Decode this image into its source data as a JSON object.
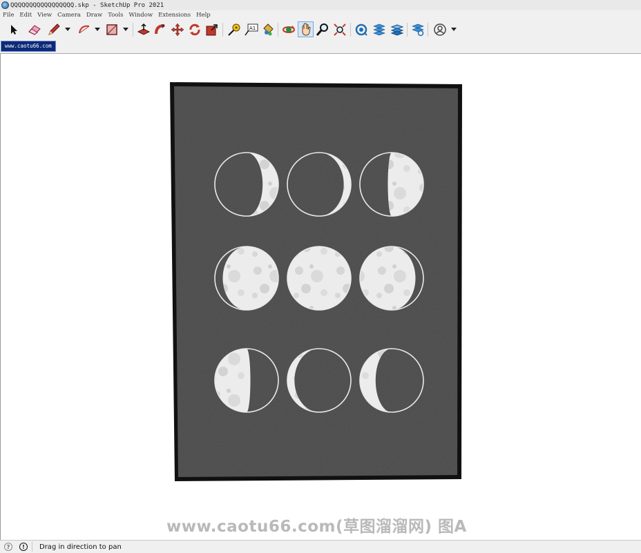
{
  "window": {
    "title": "QQQQQQQQQQQQQQQQQ.skp - SketchUp Pro 2021"
  },
  "menu": {
    "items": [
      "File",
      "Edit",
      "View",
      "Camera",
      "Draw",
      "Tools",
      "Window",
      "Extensions",
      "Help"
    ]
  },
  "toolbar": {
    "tools": [
      {
        "icon": "select-arrow-icon"
      },
      {
        "icon": "eraser-icon"
      },
      {
        "icon": "pencil-line-icon",
        "dropdown": true
      },
      {
        "icon": "arc-icon",
        "dropdown": true
      },
      {
        "icon": "rectangle-icon",
        "dropdown": true
      },
      {
        "icon": "push-pull-icon"
      },
      {
        "icon": "follow-me-icon"
      },
      {
        "icon": "move-icon"
      },
      {
        "icon": "rotate-icon"
      },
      {
        "icon": "scale-icon"
      },
      {
        "icon": "tape-measure-icon"
      },
      {
        "icon": "text-icon",
        "text": "A1"
      },
      {
        "icon": "paint-bucket-icon"
      },
      {
        "icon": "orbit-icon"
      },
      {
        "icon": "pan-hand-icon",
        "active": true
      },
      {
        "icon": "zoom-icon"
      },
      {
        "icon": "zoom-extents-icon"
      },
      {
        "icon": "3d-warehouse-icon"
      },
      {
        "icon": "extension-warehouse-icon"
      },
      {
        "icon": "layout-icon"
      },
      {
        "icon": "extension-manager-icon"
      },
      {
        "icon": "account-icon",
        "dropdown": true
      }
    ]
  },
  "scene_tab": {
    "label": "www.caotu66.com"
  },
  "viewport": {
    "poster_frame_color": "#111111",
    "poster_board_color": "#484848",
    "moon_color": "#e9e9e9",
    "moon_phases": [
      [
        "waxing-crescent",
        "first-quarter-thin",
        "first-quarter"
      ],
      [
        "waxing-gibbous",
        "full-moon",
        "waning-gibbous"
      ],
      [
        "third-quarter",
        "waning-crescent",
        "new-moon-thin"
      ]
    ],
    "watermark": "www.caotu66.com(草图溜溜网) 图A"
  },
  "status": {
    "message": "Drag in direction to pan"
  }
}
